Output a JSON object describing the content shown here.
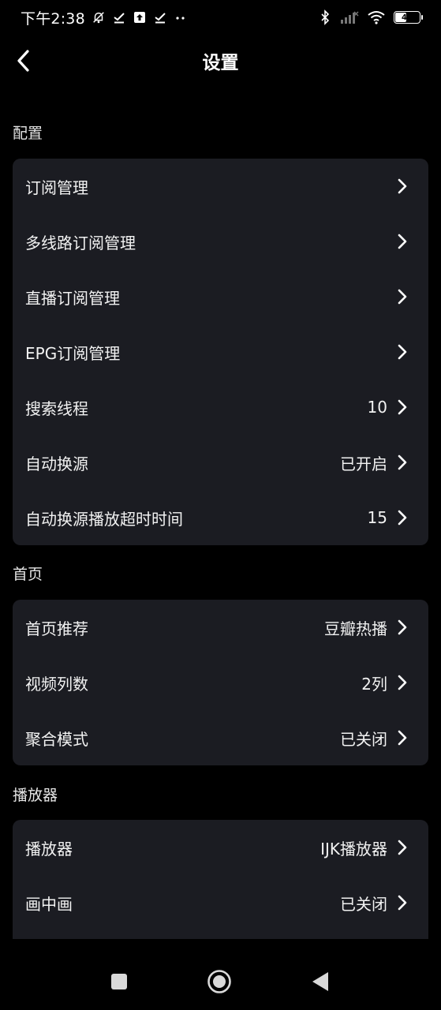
{
  "status_bar": {
    "time": "下午2:38",
    "battery": "46",
    "icons": [
      "mute-icon",
      "check-icon",
      "upload-icon",
      "check-icon",
      "more-dots-icon",
      "bluetooth-icon",
      "cellular-signal-icon",
      "wifi-icon",
      "battery-icon"
    ]
  },
  "header": {
    "title": "设置",
    "back_icon": "chevron-left-icon"
  },
  "sections": {
    "config": {
      "label": "配置",
      "items": [
        {
          "label": "订阅管理",
          "value": ""
        },
        {
          "label": "多线路订阅管理",
          "value": ""
        },
        {
          "label": "直播订阅管理",
          "value": ""
        },
        {
          "label": "EPG订阅管理",
          "value": ""
        },
        {
          "label": "搜索线程",
          "value": "10"
        },
        {
          "label": "自动换源",
          "value": "已开启"
        },
        {
          "label": "自动换源播放超时时间",
          "value": "15"
        }
      ]
    },
    "home": {
      "label": "首页",
      "items": [
        {
          "label": "首页推荐",
          "value": "豆瓣热播"
        },
        {
          "label": "视频列数",
          "value": "2列"
        },
        {
          "label": "聚合模式",
          "value": "已关闭"
        }
      ]
    },
    "player": {
      "label": "播放器",
      "items": [
        {
          "label": "播放器",
          "value": "IJK播放器"
        },
        {
          "label": "画中画",
          "value": "已关闭"
        }
      ]
    }
  },
  "nav_bar": {
    "icons": [
      "recents-square-icon",
      "home-circle-icon",
      "back-triangle-icon"
    ]
  },
  "colors": {
    "background": "#000000",
    "card": "#1b1c22",
    "text": "#f2f2f2"
  }
}
